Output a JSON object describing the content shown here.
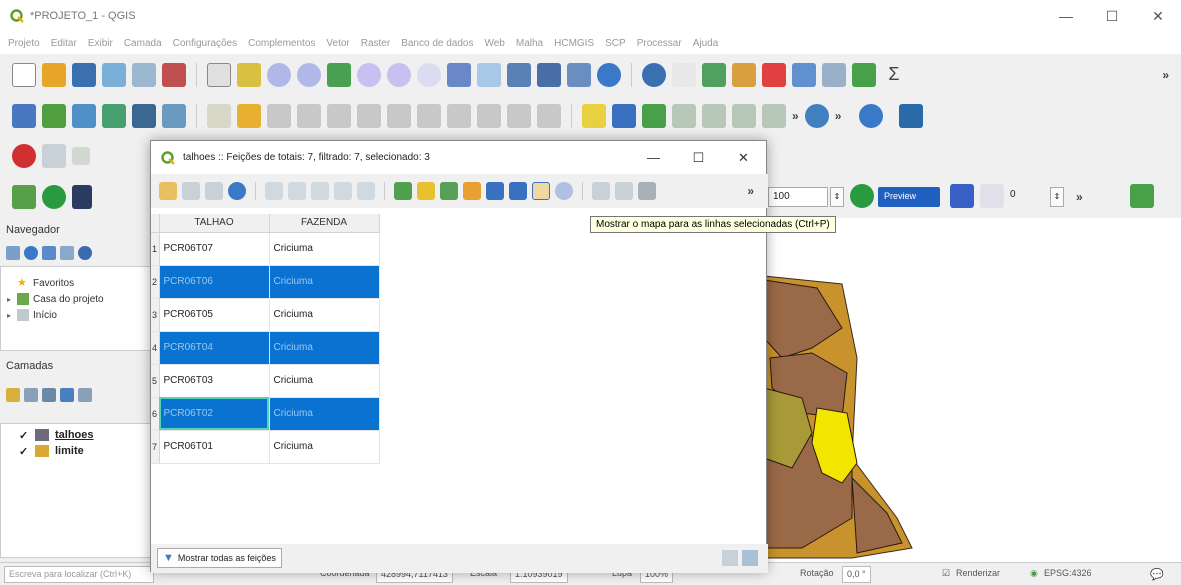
{
  "window": {
    "title": "*PROJETO_1 - QGIS",
    "minimize": "—",
    "maximize": "☐",
    "close": "✕"
  },
  "menu": [
    "Projeto",
    "Editar",
    "Exibir",
    "Camada",
    "Configurações",
    "Complementos",
    "Vetor",
    "Raster",
    "Banco de dados",
    "Web",
    "Malha",
    "HCMGIS",
    "SCP",
    "Processar",
    "Ajuda"
  ],
  "toolbar": {
    "more": "»",
    "scale_value": "100",
    "preview_label": "Preview",
    "slider_value": "0"
  },
  "navigator": {
    "header": "Navegador",
    "items": [
      {
        "label": "Favoritos"
      },
      {
        "label": "Casa do projeto"
      },
      {
        "label": "Início"
      }
    ]
  },
  "layers_panel": {
    "header": "Camadas",
    "layers": [
      {
        "name": "talhoes",
        "color": "#6b6b7b",
        "checked": "✓"
      },
      {
        "name": "limite",
        "color": "#d9a935",
        "checked": "✓"
      }
    ]
  },
  "dialog": {
    "title": "talhoes :: Feições de totais: 7, filtrado: 7, selecionado: 3",
    "minimize": "—",
    "maximize": "☐",
    "close": "✕",
    "more": "»",
    "columns": [
      "TALHAO",
      "FAZENDA"
    ],
    "rows": [
      {
        "num": "1",
        "talhao": "PCR06T07",
        "fazenda": "Criciuma",
        "selected": false
      },
      {
        "num": "2",
        "talhao": "PCR06T06",
        "fazenda": "Criciuma",
        "selected": true
      },
      {
        "num": "3",
        "talhao": "PCR06T05",
        "fazenda": "Criciuma",
        "selected": false
      },
      {
        "num": "4",
        "talhao": "PCR06T04",
        "fazenda": "Criciuma",
        "selected": true
      },
      {
        "num": "5",
        "talhao": "PCR06T03",
        "fazenda": "Criciuma",
        "selected": false
      },
      {
        "num": "6",
        "talhao": "PCR06T02",
        "fazenda": "Criciuma",
        "selected": true,
        "current": true
      },
      {
        "num": "7",
        "talhao": "PCR06T01",
        "fazenda": "Criciuma",
        "selected": false
      }
    ],
    "filter_button": "Mostrar todas as feições"
  },
  "tooltip": "Mostrar o mapa para as linhas selecionadas (Ctrl+P)",
  "statusbar": {
    "locator_placeholder": "Escreva para localizar (Ctrl+K)",
    "coordinate_label": "Coordenada",
    "coordinate_value": "428994,7117413",
    "scale_label": "Escala",
    "scale_value": "1:10939019",
    "magnifier_label": "Lupa",
    "magnifier_value": "100%",
    "rotation_label": "Rotação",
    "rotation_value": "0,0 °",
    "render_label": "Renderizar",
    "crs": "EPSG:4326"
  },
  "colors": {
    "selection": "#0a72d1",
    "map_brown": "#9a6a48",
    "map_ochre": "#c8922c",
    "map_yellow": "#f2e500",
    "map_khaki": "#a89a38"
  }
}
